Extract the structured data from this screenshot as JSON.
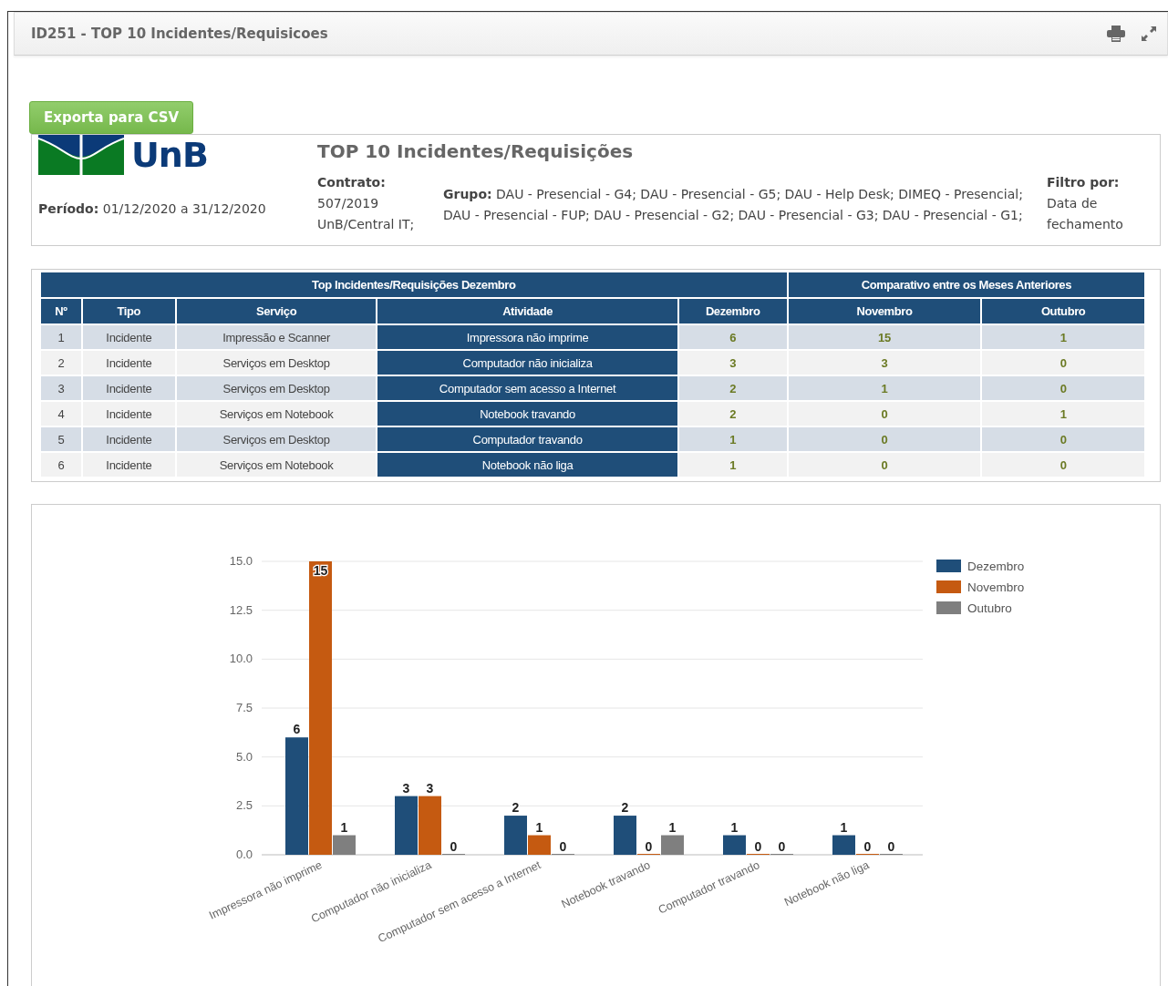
{
  "header": {
    "title": "ID251 - TOP 10 Incidentes/Requisicoes"
  },
  "export_button": "Exporta para CSV",
  "report": {
    "logo_text": "UnB",
    "title": "TOP 10 Incidentes/Requisições",
    "periodo": {
      "label": "Período:",
      "value": "01/12/2020 a 31/12/2020"
    },
    "contrato": {
      "label": "Contrato:",
      "lines": [
        "507/2019",
        "UnB/Central IT;"
      ]
    },
    "grupo": {
      "label": "Grupo:",
      "lines": [
        "DAU - Presencial - G4; DAU - Presencial - G5; DAU - Help Desk; DIMEQ - Presencial;",
        "DAU - Presencial - FUP; DAU - Presencial - G2; DAU - Presencial - G3; DAU - Presencial - G1;"
      ]
    },
    "filtro": {
      "label": "Filtro por:",
      "lines": [
        "Data de",
        "fechamento"
      ]
    }
  },
  "table": {
    "groups": [
      {
        "label": "Top Incidentes/Requisições Dezembro",
        "columns": [
          {
            "label": "Nº",
            "kind": "text"
          },
          {
            "label": "Tipo",
            "kind": "text"
          },
          {
            "label": "Serviço",
            "kind": "text"
          },
          {
            "label": "Atividade",
            "kind": "highlight"
          },
          {
            "label": "Dezembro",
            "kind": "count"
          }
        ]
      },
      {
        "label": "Comparativo entre os Meses Anteriores",
        "columns": [
          {
            "label": "Novembro",
            "kind": "count"
          },
          {
            "label": "Outubro",
            "kind": "count"
          }
        ]
      }
    ],
    "rows": [
      {
        "cells": [
          "1",
          "Incidente",
          "Impressão e Scanner",
          "Impressora não imprime",
          "6",
          "15",
          "1"
        ]
      },
      {
        "cells": [
          "2",
          "Incidente",
          "Serviços em Desktop",
          "Computador não inicializa",
          "3",
          "3",
          "0"
        ]
      },
      {
        "cells": [
          "3",
          "Incidente",
          "Serviços em Desktop",
          "Computador sem acesso a Internet",
          "2",
          "1",
          "0"
        ]
      },
      {
        "cells": [
          "4",
          "Incidente",
          "Serviços em Notebook",
          "Notebook travando",
          "2",
          "0",
          "1"
        ]
      },
      {
        "cells": [
          "5",
          "Incidente",
          "Serviços em Desktop",
          "Computador travando",
          "1",
          "0",
          "0"
        ]
      },
      {
        "cells": [
          "6",
          "Incidente",
          "Serviços em Notebook",
          "Notebook não liga",
          "1",
          "0",
          "0"
        ]
      }
    ]
  },
  "chart": {
    "chart_data": {
      "type": "bar",
      "categories": [
        "Impressora não imprime",
        "Computador não inicializa",
        "Computador sem acesso a Internet",
        "Notebook travando",
        "Computador travando",
        "Notebook não liga"
      ],
      "series": [
        {
          "name": "Dezembro",
          "color": "#1f4e79",
          "values": [
            6,
            3,
            2,
            2,
            1,
            1
          ]
        },
        {
          "name": "Novembro",
          "color": "#c55a11",
          "values": [
            15,
            3,
            1,
            0,
            0,
            0
          ]
        },
        {
          "name": "Outubro",
          "color": "#7f7f7f",
          "values": [
            1,
            0,
            0,
            1,
            0,
            0
          ]
        }
      ],
      "ylim": [
        0,
        15
      ],
      "yticks": [
        {
          "value": 0,
          "label": "0.0"
        },
        {
          "value": 2.5,
          "label": "2.5"
        },
        {
          "value": 5,
          "label": "5.0"
        },
        {
          "value": 7.5,
          "label": "7.5"
        },
        {
          "value": 10,
          "label": "10.0"
        },
        {
          "value": 12.5,
          "label": "12.5"
        },
        {
          "value": 15,
          "label": "15.0"
        }
      ],
      "data_labels": true,
      "grid": true,
      "legend": "right"
    }
  }
}
